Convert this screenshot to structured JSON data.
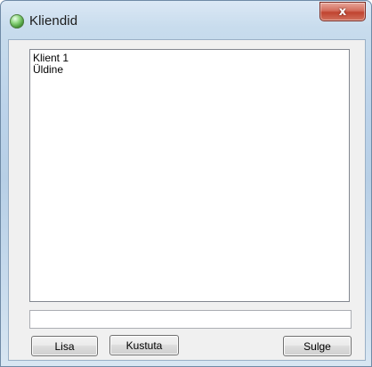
{
  "window": {
    "title": "Kliendid",
    "icon": "green-orb-icon",
    "close_glyph": "x"
  },
  "clients_list": {
    "items": [
      "Klient 1",
      "Üldine"
    ]
  },
  "name_input": {
    "value": ""
  },
  "buttons": {
    "add_label": "Lisa",
    "delete_label": "Kustuta",
    "close_label": "Sulge"
  },
  "colors": {
    "close_button": "#c8503c",
    "frame": "#bcd3ea",
    "client_area": "#f0f0f0"
  }
}
